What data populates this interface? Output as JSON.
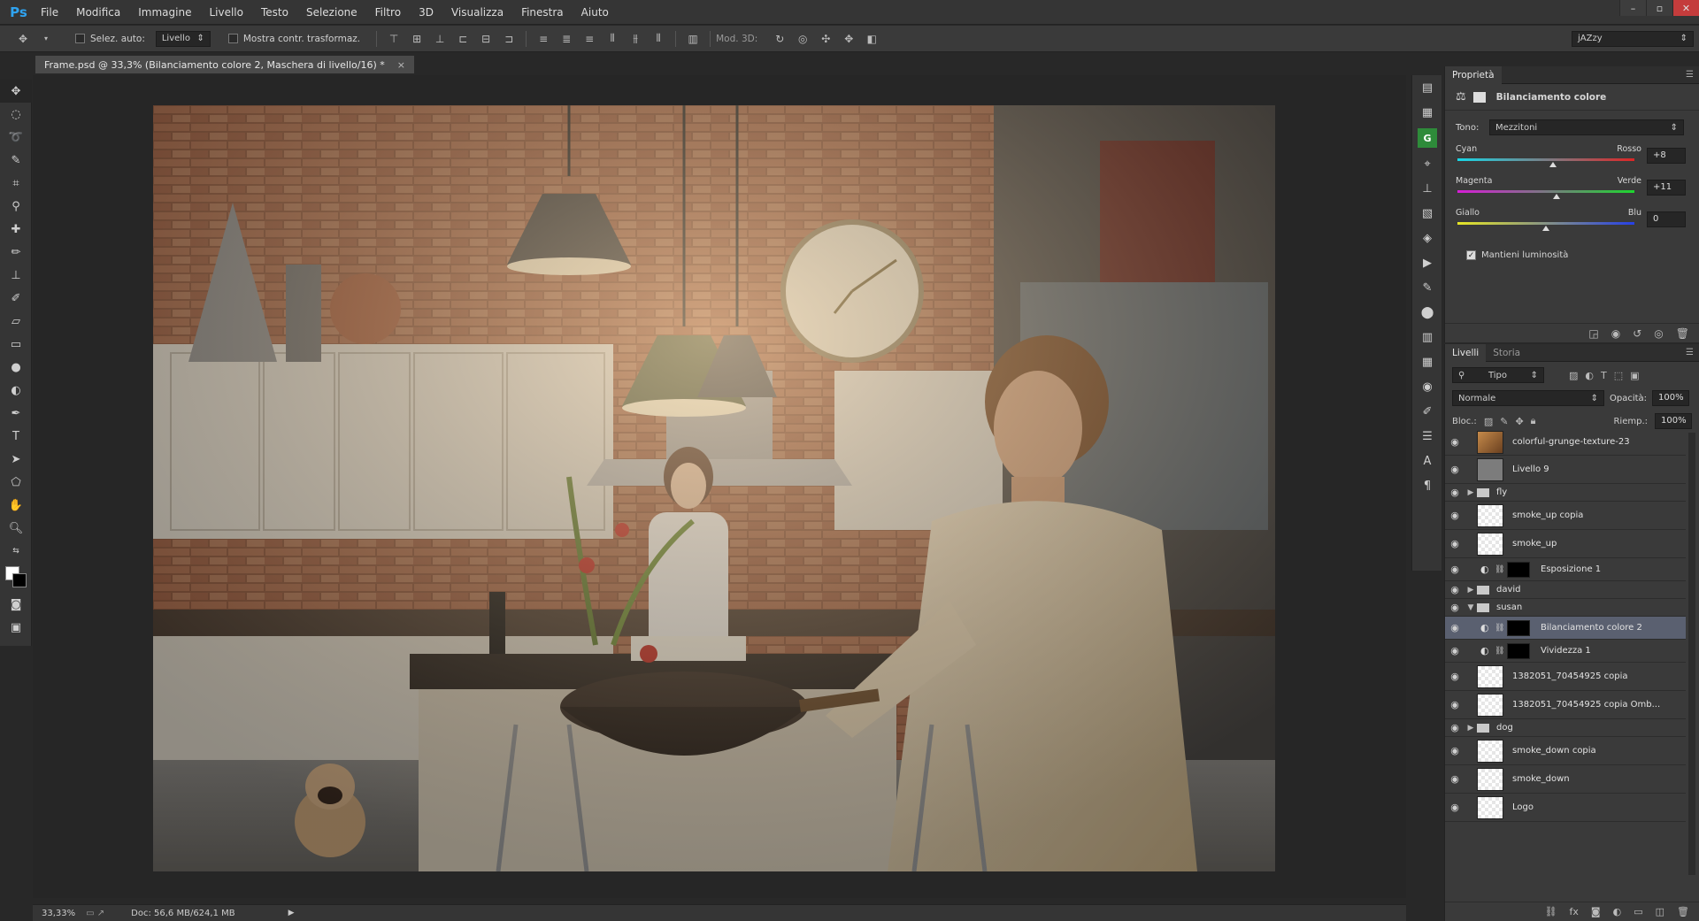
{
  "app": {
    "logo": "Ps",
    "menu": [
      "File",
      "Modifica",
      "Immagine",
      "Livello",
      "Testo",
      "Selezione",
      "Filtro",
      "3D",
      "Visualizza",
      "Finestra",
      "Aiuto"
    ],
    "window_controls": [
      "–",
      "▫",
      "✕"
    ]
  },
  "options_bar": {
    "auto_select_label": "Selez. auto:",
    "auto_select_value": "Livello",
    "show_transform_label": "Mostra contr. trasformaz.",
    "mode3d_label": "Mod. 3D:",
    "workspace": "jAZzy"
  },
  "document": {
    "tab_title": "Frame.psd @ 33,3% (Bilanciamento colore 2, Maschera di livello/16) *",
    "close": "×"
  },
  "status": {
    "zoom": "33,33%",
    "doc_info": "Doc: 56,6 MB/624,1 MB"
  },
  "properties": {
    "tabs": [
      "Proprietà"
    ],
    "title": "Bilanciamento colore",
    "tone_label": "Tono:",
    "tone_value": "Mezzitoni",
    "sliders": [
      {
        "left": "Cyan",
        "right": "Rosso",
        "value": "+8",
        "pos": 0.54
      },
      {
        "left": "Magenta",
        "right": "Verde",
        "value": "+11",
        "pos": 0.56
      },
      {
        "left": "Giallo",
        "right": "Blu",
        "value": "0",
        "pos": 0.5
      }
    ],
    "preserve_label": "Mantieni luminosità"
  },
  "layers_panel": {
    "tabs": [
      "Livelli",
      "Storia"
    ],
    "filter_value": "Tipo",
    "blend_mode": "Normale",
    "opacity_label": "Opacità:",
    "opacity_value": "100%",
    "lock_label": "Bloc.:",
    "fill_label": "Riemp.:",
    "fill_value": "100%",
    "layers": [
      {
        "name": "colorful-grunge-texture-23",
        "kind": "image"
      },
      {
        "name": "Livello 9",
        "kind": "gray"
      },
      {
        "name": "fly",
        "kind": "group"
      },
      {
        "name": "smoke_up copia",
        "kind": "checker"
      },
      {
        "name": "smoke_up",
        "kind": "checker"
      },
      {
        "name": "Esposizione 1",
        "kind": "adjust"
      },
      {
        "name": "david",
        "kind": "group"
      },
      {
        "name": "susan",
        "kind": "group-open"
      },
      {
        "name": "Bilanciamento colore 2",
        "kind": "adjust-selected"
      },
      {
        "name": "Vividezza 1",
        "kind": "adjust"
      },
      {
        "name": "1382051_70454925 copia",
        "kind": "checker"
      },
      {
        "name": "1382051_70454925 copia Omb...",
        "kind": "checker"
      },
      {
        "name": "dog",
        "kind": "group"
      },
      {
        "name": "smoke_down copia",
        "kind": "checker"
      },
      {
        "name": "smoke_down",
        "kind": "checker"
      },
      {
        "name": "Logo",
        "kind": "checker"
      }
    ]
  },
  "colors": {
    "accent": "#2fa3f0",
    "selected": "#5a6070"
  }
}
